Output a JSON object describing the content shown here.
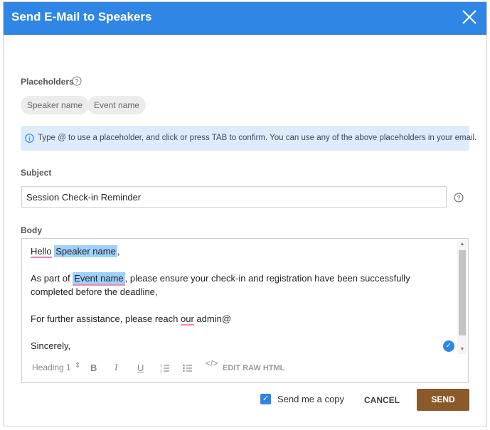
{
  "dialog": {
    "title": "Send E-Mail to Speakers",
    "colors": {
      "header": "#2f86e5",
      "send_button": "#8b5a2b",
      "placeholder_highlight": "#9fd0fb",
      "info_bg": "#deebfb"
    }
  },
  "placeholders": {
    "label": "Placeholders",
    "chips": [
      "Speaker name",
      "Event name"
    ]
  },
  "info": {
    "text": "Type @ to use a placeholder, and click or press TAB to confirm. You can use any of the above placeholders in your email."
  },
  "subject": {
    "label": "Subject",
    "value": "Session Check-in Reminder"
  },
  "body": {
    "label": "Body",
    "line1_prefix": "Hello",
    "line1_chip": "Speaker name",
    "line1_suffix": ",",
    "line2_prefix": "As part of",
    "line2_chip": "Event name",
    "line2_suffix": ", please ensure your check-in and registration have been successfully completed before the deadline,",
    "line3_prefix": "For further assistance, please reach",
    "line3_spell": "our",
    "line3_suffix": "admin@",
    "line4": "Sincerely,"
  },
  "toolbar": {
    "heading": "Heading 1",
    "heading_arrow": "⇕",
    "bold": "B",
    "italic": "I",
    "underline": "U",
    "ordered_list": "ordered-list-icon",
    "bullet_list": "bullet-list-icon",
    "code": "</>",
    "raw_html": "EDIT RAW HTML"
  },
  "footer": {
    "copy_label": "Send me a copy",
    "copy_checked": true,
    "cancel": "CANCEL",
    "send": "SEND"
  }
}
